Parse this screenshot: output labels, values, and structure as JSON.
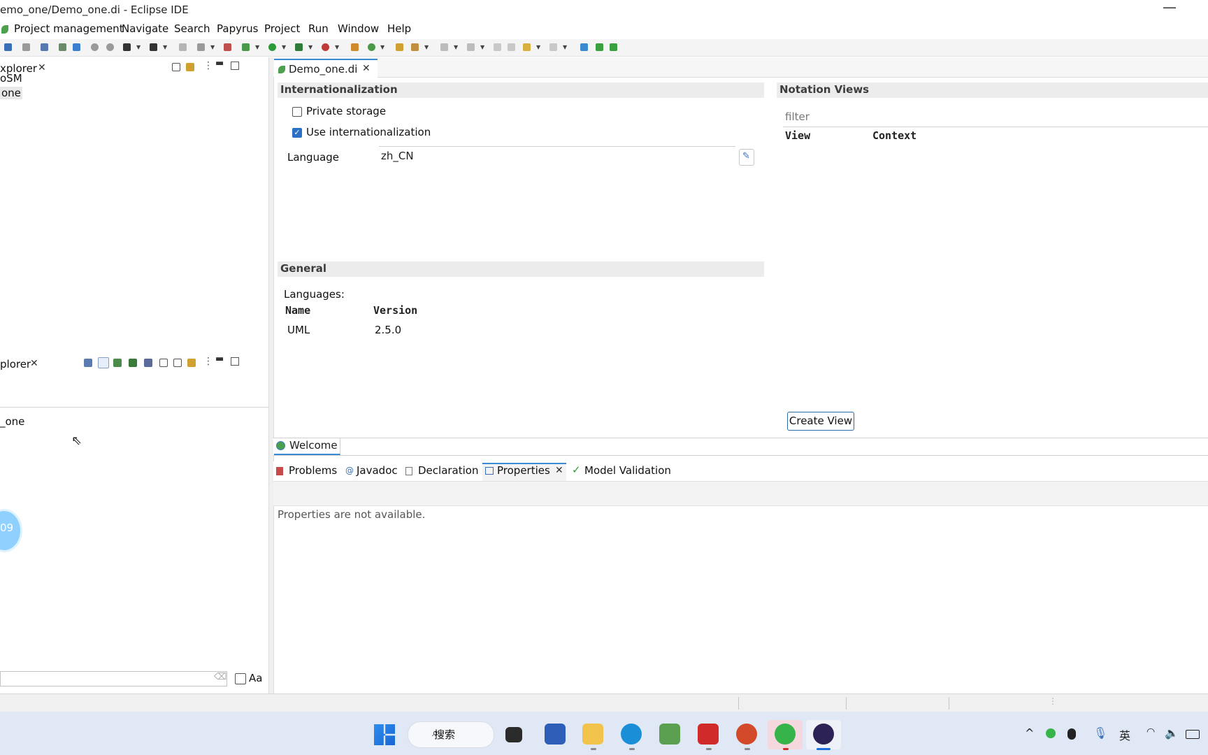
{
  "window": {
    "title": "emo_one/Demo_one.di - Eclipse IDE",
    "minimize_glyph": "—"
  },
  "menu": [
    "Project management",
    "Navigate",
    "Search",
    "Papyrus",
    "Project",
    "Run",
    "Window",
    "Help"
  ],
  "left_top_panel": {
    "tab_label": "xplorer",
    "items": [
      "oSM",
      "one"
    ]
  },
  "left_bottom_panel": {
    "tab_label": "plorer",
    "items": [
      "_one"
    ],
    "clock_badge": "09",
    "case_label": "Aa"
  },
  "editor": {
    "tab_label": "Demo_one.di",
    "internationalization": {
      "heading": "Internationalization",
      "private_storage": "Private storage",
      "private_storage_checked": false,
      "use_i18n": "Use internationalization",
      "use_i18n_checked": true,
      "language_label": "Language",
      "language_value": "zh_CN"
    },
    "general": {
      "heading": "General",
      "languages_label": "Languages:",
      "columns": [
        "Name",
        "Version"
      ],
      "rows": [
        [
          "UML",
          "2.5.0"
        ]
      ]
    },
    "notation_views": {
      "heading": "Notation Views",
      "filter_placeholder": "filter",
      "columns": [
        "View",
        "Context"
      ],
      "create_button": "Create View"
    }
  },
  "welcome_tab": "Welcome",
  "bottom_panel": {
    "tabs": [
      "Problems",
      "Javadoc",
      "Declaration",
      "Properties",
      "Model Validation"
    ],
    "message": "Properties are not available."
  },
  "taskbar": {
    "search_label": "搜索",
    "ime_label": "英"
  },
  "colors": {
    "accent": "#3b8bd4",
    "section_bg": "#ececec",
    "taskbar_bg": "#dfe8f4"
  }
}
